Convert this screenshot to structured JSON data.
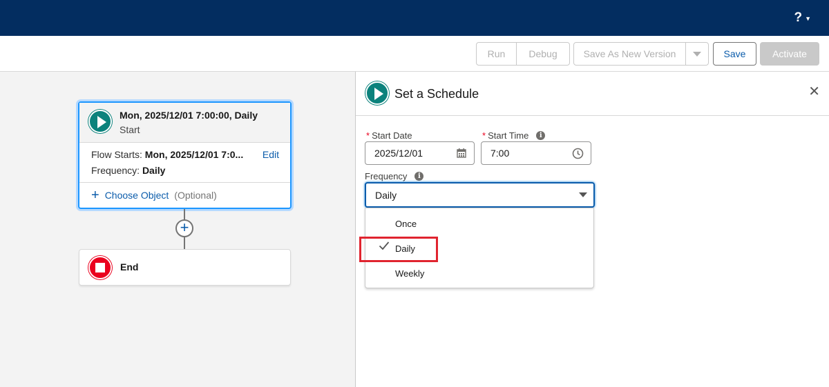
{
  "header": {
    "help_label": "?"
  },
  "toolbar": {
    "run": "Run",
    "debug": "Debug",
    "save_as_new": "Save As New Version",
    "save": "Save",
    "activate": "Activate"
  },
  "canvas": {
    "start_card": {
      "title": "Mon, 2025/12/01 7:00:00, Daily",
      "subtitle": "Start",
      "flow_starts_label": "Flow Starts:",
      "flow_starts_value": "Mon, 2025/12/01 7:0...",
      "edit": "Edit",
      "frequency_label": "Frequency:",
      "frequency_value": "Daily",
      "choose_object": "Choose Object",
      "optional": "(Optional)"
    },
    "end_card": {
      "title": "End"
    }
  },
  "panel": {
    "title": "Set a Schedule",
    "start_date": {
      "required": "*",
      "label": "Start Date",
      "value": "2025/12/01"
    },
    "start_time": {
      "required": "*",
      "label": "Start Time",
      "value": "7:00"
    },
    "frequency": {
      "label": "Frequency",
      "value": "Daily",
      "options": [
        "Once",
        "Daily",
        "Weekly"
      ],
      "selected_option": "Daily"
    }
  },
  "colors": {
    "header_bg": "#032d60",
    "start_icon": "#0b827c",
    "end_icon": "#ea001e",
    "link": "#0b5cab",
    "highlight_box": "#e0242f"
  },
  "icons": {
    "help": "question-icon",
    "start": "play-icon",
    "end": "stop-icon",
    "date": "calendar-icon",
    "time": "clock-icon",
    "info": "info-icon",
    "close": "close-icon",
    "check": "check-icon"
  }
}
